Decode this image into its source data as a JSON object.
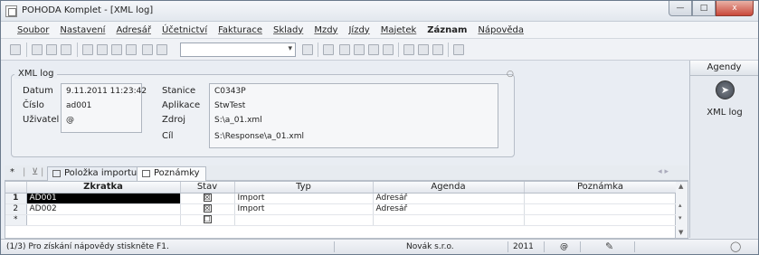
{
  "window": {
    "title": "POHODA Komplet - [XML log]",
    "buttons": {
      "minimize": "—",
      "maximize": "□",
      "close": "x"
    }
  },
  "menu": [
    "Soubor",
    "Nastavení",
    "Adresář",
    "Účetnictví",
    "Fakturace",
    "Sklady",
    "Mzdy",
    "Jízdy",
    "Majetek",
    "Záznam",
    "Nápověda"
  ],
  "menu_bold": "Záznam",
  "toolbar": {
    "combo_value": ""
  },
  "panel": {
    "legend": "XML log",
    "fields": {
      "datum_label": "Datum",
      "datum_value": "9.11.2011 11:23:42",
      "cislo_label": "Číslo",
      "cislo_value": "ad001",
      "uzivatel_label": "Uživatel",
      "uzivatel_value": "@",
      "stanice_label": "Stanice",
      "stanice_value": "C0343P",
      "aplikace_label": "Aplikace",
      "aplikace_value": "StwTest",
      "zdroj_label": "Zdroj",
      "zdroj_value": "S:\\a_01.xml",
      "cil_label": "Cíl",
      "cil_value": "S:\\Response\\a_01.xml"
    }
  },
  "agendy": {
    "header": "Agendy",
    "item_label": "XML log"
  },
  "tabs": {
    "star": "*",
    "import_label": "Položka importu",
    "notes_label": "Poznámky"
  },
  "grid": {
    "columns": [
      "Zkratka",
      "Stav",
      "Typ",
      "Agenda",
      "Poznámka"
    ],
    "rows": [
      {
        "num": "1",
        "zkratka": "AD001",
        "stav": "☒",
        "typ": "Import",
        "agenda": "Adresář",
        "poznamka": ""
      },
      {
        "num": "2",
        "zkratka": "AD002",
        "stav": "☒",
        "typ": "Import",
        "agenda": "Adresář",
        "poznamka": ""
      },
      {
        "num": "*",
        "zkratka": "",
        "stav": "☐",
        "typ": "",
        "agenda": "",
        "poznamka": ""
      }
    ]
  },
  "status": {
    "hint": "(1/3) Pro získání nápovědy stiskněte F1.",
    "company": "Novák s.r.o.",
    "year": "2011",
    "user": "@"
  }
}
